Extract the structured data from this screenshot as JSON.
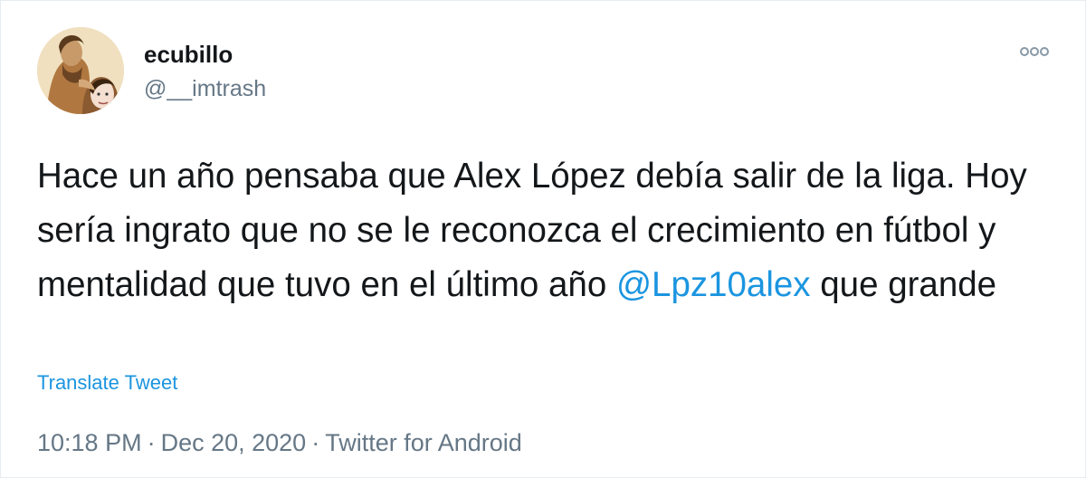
{
  "user": {
    "display_name": "ecubillo",
    "handle": "@__imtrash",
    "avatar_icon": "profile-photo"
  },
  "header": {
    "more_icon": "more-options-icon"
  },
  "tweet": {
    "text_parts": [
      "Hace un año pensaba que Alex López debía salir de la liga. Hoy sería ingrato que no se le reconozca el crecimiento en fútbol y mentalidad que tuvo en el último año ",
      "@Lpz10alex",
      " que grande"
    ],
    "translate_label": "Translate Tweet"
  },
  "meta": {
    "time": "10:18 PM",
    "separator": "·",
    "date": "Dec 20, 2020",
    "source": "Twitter for Android"
  },
  "colors": {
    "text": "#14171a",
    "secondary": "#657786",
    "link": "#1b95e0",
    "border": "#e6ecf0"
  }
}
